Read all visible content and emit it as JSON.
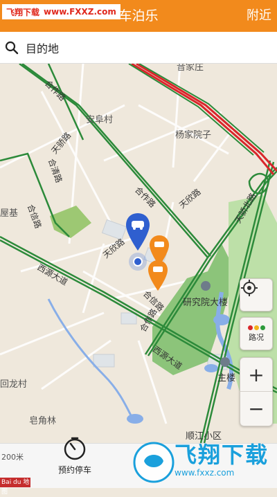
{
  "watermark": {
    "left": "飞翔下载",
    "right": "www.FXXZ.com",
    "brand": "飞翔下载",
    "brand_url": "www.fxxz.com"
  },
  "header": {
    "title": "车泊乐",
    "nearby_label": "附近"
  },
  "search": {
    "placeholder": "目的地"
  },
  "map": {
    "places": [
      "音家庄",
      "安阜村",
      "杨家院子",
      "研究院大楼",
      "主楼",
      "回龙村",
      "皂角林",
      "顺江小区",
      "屋基"
    ],
    "roads": [
      "合作路",
      "天骄路",
      "合清路",
      "合作路",
      "天欣路",
      "合信路",
      "西源大道",
      "天欣路",
      "合信路",
      "西源大道",
      "天骄北路",
      "合作路"
    ],
    "scale_text": "200米",
    "baidu_text": "Bai du 地图"
  },
  "controls": {
    "traffic_label": "路况",
    "zoom_in": "+",
    "zoom_out": "−"
  },
  "bottom": {
    "reserve_label": "预约停车"
  },
  "colors": {
    "header": "#f28a1c",
    "road": "#2c8a3a",
    "congestion": "#d9262b",
    "pin_blue": "#2f5fcf",
    "pin_orange": "#f28a1c"
  }
}
